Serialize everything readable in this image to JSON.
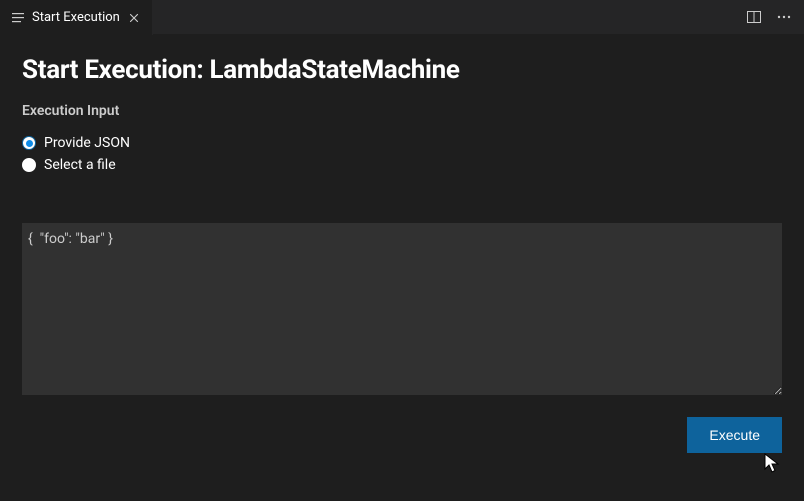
{
  "tab": {
    "title": "Start Execution"
  },
  "page": {
    "title": "Start Execution: LambdaStateMachine",
    "sectionLabel": "Execution Input"
  },
  "radios": {
    "json": "Provide JSON",
    "file": "Select a file"
  },
  "textarea": {
    "value": "{  \"foo\": \"bar\" }"
  },
  "buttons": {
    "execute": "Execute"
  }
}
